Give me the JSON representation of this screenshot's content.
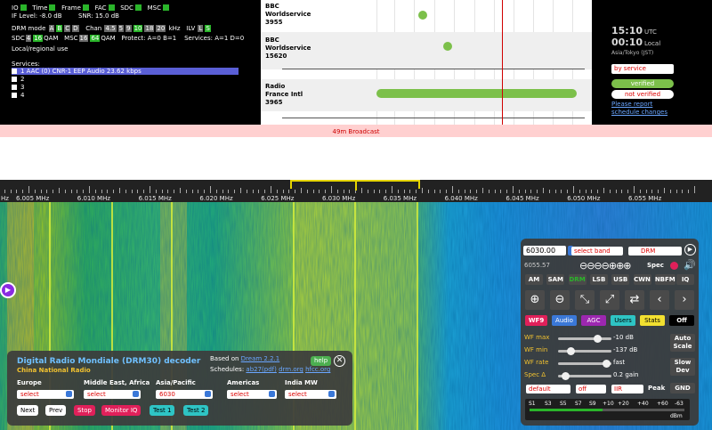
{
  "status": {
    "io": "IO",
    "time": "Time",
    "frame": "Frame",
    "fac": "FAC",
    "sdc": "SDC",
    "msc": "MSC",
    "if_level": "IF Level: -8.0 dB",
    "snr": "SNR: 15.0 dB",
    "drm_mode_label": "DRM mode",
    "drm_modes": [
      "A",
      "B",
      "C",
      "D"
    ],
    "drm_mode_active": "B",
    "chan_label": "Chan",
    "chan_values": [
      "4.5",
      "5",
      "9",
      "10",
      "18",
      "20"
    ],
    "chan_active": "10",
    "chan_unit": "kHz",
    "ilv_label": "ILV",
    "ilv_values": [
      "L",
      "S"
    ],
    "ilv_active": "S",
    "sdc_label": "SDC",
    "sdc_values": [
      "4",
      "16"
    ],
    "sdc_active": "16",
    "qam1": "QAM",
    "msc_label": "MSC",
    "msc_values": [
      "16",
      "64"
    ],
    "msc_active": "64",
    "qam2": "QAM",
    "protect": "Protect: A=0 B=1",
    "services_count": "Services: A=1 D=0",
    "local_regional": "Local/regional use",
    "services_title": "Services:",
    "services": [
      {
        "label": "1 AAC (0) CNR-1 EEP Audio 23.62 kbps",
        "selected": true
      },
      {
        "label": "2",
        "selected": false
      },
      {
        "label": "3",
        "selected": false
      },
      {
        "label": "4",
        "selected": false
      }
    ]
  },
  "schedule": {
    "rows": [
      {
        "station": [
          "BBC",
          "Worldservice",
          "3955"
        ]
      },
      {
        "station": [
          "BBC",
          "Worldservice",
          "15620"
        ]
      },
      {
        "station": [
          "Radio",
          "France Intl",
          "3965"
        ]
      }
    ]
  },
  "info": {
    "utc_time": "15:10",
    "utc_label": "UTC",
    "local_time": "00:10",
    "local_label": "Local",
    "timezone": "Asia/Tokyo (JST)",
    "sort_select": "by service",
    "verified": "verified",
    "not_verified": "not verified",
    "report_line1": "Please report",
    "report_line2": "schedule changes"
  },
  "band": {
    "name": "49m Broadcast"
  },
  "scale": {
    "left_edge": "Hz",
    "labels": [
      "6.005 MHz",
      "6.010 MHz",
      "6.015 MHz",
      "6.020 MHz",
      "6.025 MHz",
      "6.030 MHz",
      "6.035 MHz",
      "6.040 MHz",
      "6.045 MHz",
      "6.050 MHz",
      "6.055 MHz"
    ]
  },
  "drm_panel": {
    "title": "Digital Radio Mondiale (DRM30) decoder",
    "station": "China National Radio",
    "based_on_prefix": "Based on",
    "based_on_link": "Dream 2.2.1",
    "help": "help",
    "close": "✕",
    "schedules_prefix": "Schedules:",
    "schedule_links": [
      "ab27(pdf)",
      "drm.org",
      "hfcc.org"
    ],
    "regions": [
      {
        "label": "Europe",
        "value": "select"
      },
      {
        "label": "Middle East, Africa",
        "value": "select"
      },
      {
        "label": "Asia/Pacific",
        "value": "6030"
      },
      {
        "label": "Americas",
        "value": "select"
      },
      {
        "label": "India MW",
        "value": "select"
      }
    ],
    "buttons": {
      "next": "Next",
      "prev": "Prev",
      "stop": "Stop",
      "monitor": "Monitor IQ",
      "test1": "Test 1",
      "test2": "Test 2"
    }
  },
  "control": {
    "freq": "6030.00",
    "band_select": "select band",
    "mode_select": "DRM",
    "freq_small": "6055.57",
    "spec": "Spec",
    "modes": [
      "AM",
      "SAM",
      "DRM",
      "LSB",
      "USB",
      "CWN",
      "NBFM",
      "IQ"
    ],
    "active_mode": "DRM",
    "tabs": [
      "WF9",
      "Audio",
      "AGC",
      "Users",
      "Stats",
      "Off"
    ],
    "sliders": [
      {
        "label": "WF max",
        "value": "-10 dB",
        "level": 0.72
      },
      {
        "label": "WF min",
        "value": "-137 dB",
        "level": 0.18
      },
      {
        "label": "WF rate",
        "value": "fast",
        "level": 0.9
      },
      {
        "label": "Spec Δ",
        "value": "0.2 gain",
        "level": 0.08
      }
    ],
    "side_buttons": [
      "Auto Scale",
      "Slow Dev",
      "GND"
    ],
    "dropdowns": [
      "default",
      "off",
      "IIR"
    ],
    "peak": "Peak",
    "smeter_labels": [
      "S1",
      "S3",
      "S5",
      "S7",
      "S9",
      "+10",
      "+20",
      "+40",
      "+60",
      "-63"
    ],
    "smeter_unit": "dBm",
    "smeter_level": 0.47
  }
}
